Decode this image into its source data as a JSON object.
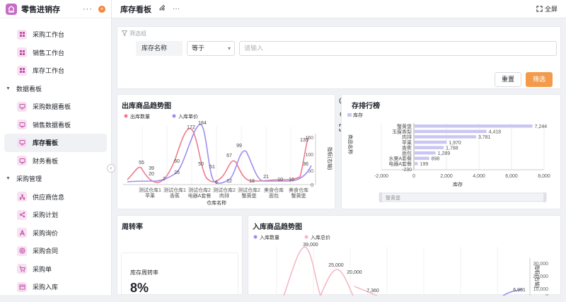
{
  "app": {
    "title": "零售进销存",
    "more": "···",
    "badge": "+"
  },
  "sidebar": {
    "items": [
      {
        "label": "采购工作台",
        "type": "item",
        "icon": "grid-icon"
      },
      {
        "label": "销售工作台",
        "type": "item",
        "icon": "grid-icon"
      },
      {
        "label": "库存工作台",
        "type": "item",
        "icon": "grid-icon"
      },
      {
        "label": "数据看板",
        "type": "group"
      },
      {
        "label": "采购数据看板",
        "type": "item",
        "icon": "dashboard-icon"
      },
      {
        "label": "销售数据看板",
        "type": "item",
        "icon": "dashboard-icon"
      },
      {
        "label": "库存看板",
        "type": "item",
        "icon": "dashboard-icon",
        "active": true
      },
      {
        "label": "财务看板",
        "type": "item",
        "icon": "dashboard-icon"
      },
      {
        "label": "采购管理",
        "type": "group"
      },
      {
        "label": "供应商信息",
        "type": "item",
        "icon": "org-icon"
      },
      {
        "label": "采购计划",
        "type": "item",
        "icon": "share-icon"
      },
      {
        "label": "采购询价",
        "type": "item",
        "icon": "letter-a-icon"
      },
      {
        "label": "采购合同",
        "type": "item",
        "icon": "at-icon"
      },
      {
        "label": "采购单",
        "type": "item",
        "icon": "cart-icon"
      },
      {
        "label": "采购入库",
        "type": "item",
        "icon": "box-icon"
      }
    ]
  },
  "topbar": {
    "title": "库存看板",
    "fullscreen": "全屏"
  },
  "filter": {
    "header": "筛选组",
    "field_label": "库存名称",
    "operator": "等于",
    "placeholder": "请输入",
    "reset_label": "重置",
    "filter_label": "筛选"
  },
  "cards": {
    "outbound_trend": "出库商品趋势图",
    "stock_rank": "存排行榜",
    "turnover": "周转率",
    "inbound_trend": "入库商品趋势图",
    "turnover_label": "库存周转率",
    "turnover_value": "8%"
  },
  "chart_data": [
    {
      "type": "line",
      "title": "出库商品趋势图",
      "xlabel": "仓库名称",
      "ylabel_right": "指标(右轴)",
      "categories": [
        "测试仓库1 苹果",
        "测试仓库1 香蕉",
        "测试仓库2 电器A套餐",
        "测试仓库2 肉排",
        "测试仓库2 蟹黄堡",
        "美食仓库 面包",
        "美食仓库 蟹黄堡"
      ],
      "series": [
        {
          "name": "出库数量",
          "color": "#f07a8e",
          "labels": [
            "55",
            "39",
            "60",
            "172",
            "50",
            "6",
            "67",
            "18",
            "21",
            "10",
            "135"
          ]
        },
        {
          "name": "入库单价",
          "color": "#9d8ef0",
          "labels": [
            "20",
            "2",
            "25",
            "184",
            "51",
            "12",
            "99",
            "16",
            "36"
          ]
        }
      ],
      "right_axis_ticks": [
        "150",
        "100",
        "50",
        "0"
      ]
    },
    {
      "type": "bar",
      "title": "存排行榜",
      "orientation": "horizontal",
      "xlabel": "库存",
      "ylabel": "商品名称",
      "legend": "库存",
      "categories": [
        "蟹黄堡",
        "玉露香梨",
        "肉排",
        "苹果",
        "香蕉",
        "面包",
        "水果A套餐",
        "电器A套餐"
      ],
      "values": [
        7244,
        4418,
        3781,
        1970,
        1788,
        1289,
        898,
        199
      ],
      "extra_labels": [
        "-230"
      ],
      "xticks": [
        "-2,000",
        "0",
        "2,000",
        "4,000",
        "6,000",
        "8,000"
      ],
      "xlim": [
        -2000,
        8000
      ],
      "color": "#c9c7f2",
      "slider_label": "蟹黄堡"
    },
    {
      "type": "line",
      "title": "入库商品趋势图",
      "series": [
        {
          "name": "入库数量",
          "color": "#9d8ef0"
        },
        {
          "name": "入库总价",
          "color": "#f5b8c4"
        }
      ],
      "labels": [
        "39,000",
        "25,000",
        "20,000",
        "7,360",
        "6,961"
      ],
      "right_axis_ticks": [
        "30,000",
        "20,000",
        "10,000",
        "0"
      ],
      "ylabel_right": "指标(右轴)"
    }
  ]
}
